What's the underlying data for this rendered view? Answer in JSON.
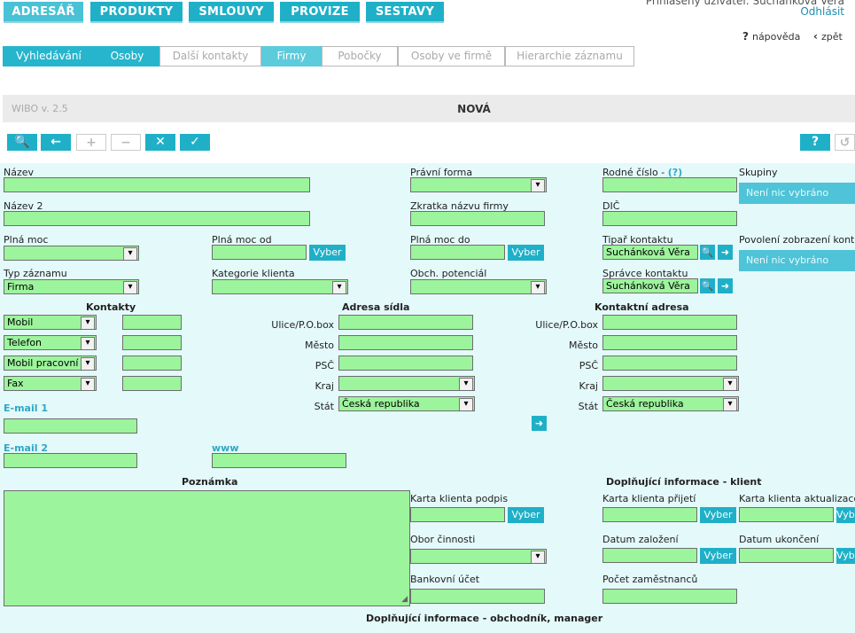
{
  "top_nav": {
    "tabs": [
      "ADRESÁŘ",
      "PRODUKTY",
      "SMLOUVY",
      "PROVIZE",
      "SESTAVY"
    ],
    "user_text": "Přihlášený uživatel:  Suchánková Věra",
    "logout": "Odhlásit",
    "help": "nápověda",
    "back": "zpět"
  },
  "sub_tabs": [
    "Vyhledávání",
    "Osoby",
    "Další kontakty",
    "Firmy",
    "Pobočky",
    "Osoby ve firmě",
    "Hierarchie záznamu"
  ],
  "titlebar": {
    "version": "WIBO v. 2.5",
    "title": "NOVÁ"
  },
  "toolbar": {
    "search_icon": "🔍",
    "back_icon": "←",
    "add_icon": "+",
    "remove_icon": "−",
    "cancel_icon": "✕",
    "confirm_icon": "✓",
    "help_icon": "?"
  },
  "form": {
    "nazev": "Název",
    "nazev2": "Název 2",
    "plna_moc": "Plná moc",
    "plna_moc_od": "Plná moc od",
    "plna_moc_do": "Plná moc do",
    "typ_zaznamu": "Typ záznamu",
    "typ_zaznamu_value": "Firma",
    "kategorie_klienta": "Kategorie klienta",
    "pravni_forma": "Právní forma",
    "zkratka": "Zkratka názvu firmy",
    "obch_potencial": "Obch. potenciál",
    "rodne_cislo": "Rodné číslo -",
    "rodne_cislo_hint": "(?)",
    "dic": "DIČ",
    "tipar": "Tipař kontaktu",
    "tipar_value": "Suchánková Věra",
    "spravce": "Správce kontaktu",
    "spravce_value": "Suchánková Věra",
    "skupiny": "Skupiny",
    "skupiny_value": "Není nic vybráno",
    "povoleni": "Povolení zobrazení kontaktu",
    "povoleni_value": "Není nic vybráno",
    "vyber": "Vyber",
    "kontakty_heading": "Kontakty",
    "contact_types": [
      "Mobil",
      "Telefon",
      "Mobil pracovní",
      "Fax"
    ],
    "email1": "E-mail 1",
    "email2": "E-mail 2",
    "www": "www",
    "adresa_sidla": "Adresa sídla",
    "kontaktni_adresa": "Kontaktní adresa",
    "ulice": "Ulice/P.O.box",
    "mesto": "Město",
    "psc": "PSČ",
    "kraj": "Kraj",
    "stat": "Stát",
    "stat_value": "Česká republika",
    "poznamka": "Poznámka",
    "dopl_klient": "Doplňující informace - klient",
    "karta_podpis": "Karta klienta podpis",
    "karta_prijeti": "Karta klienta přijetí",
    "karta_aktualizace": "Karta klienta aktualizace",
    "obor": "Obor činnosti",
    "datum_zalozeni": "Datum založení",
    "datum_ukonceni": "Datum ukončení",
    "bankovni_ucet": "Bankovní účet",
    "pocet_zam": "Počet zaměstnanců",
    "dopl_obchodnik": "Doplňující informace - obchodník, manager"
  }
}
